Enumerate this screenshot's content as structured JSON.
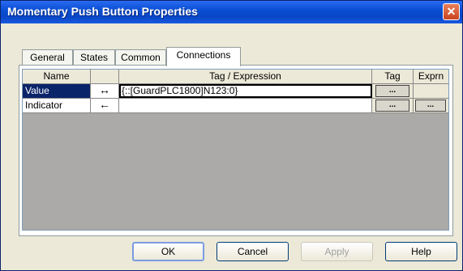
{
  "window": {
    "title": "Momentary Push Button Properties"
  },
  "tabs": [
    {
      "label": "General"
    },
    {
      "label": "States"
    },
    {
      "label": "Common"
    },
    {
      "label": "Connections"
    }
  ],
  "active_tab": "Connections",
  "grid": {
    "headers": {
      "name": "Name",
      "direction": "",
      "tag_expression": "Tag / Expression",
      "tag": "Tag",
      "exprn": "Exprn"
    },
    "rows": [
      {
        "name": "Value",
        "direction": "↔",
        "tag_expression": "{::[GuardPLC1800]N123:0}",
        "tag_button": "...",
        "exprn_button": ""
      },
      {
        "name": "Indicator",
        "direction": "←",
        "tag_expression": "",
        "tag_button": "...",
        "exprn_button": "..."
      }
    ]
  },
  "buttons": {
    "ok": "OK",
    "cancel": "Cancel",
    "apply": "Apply",
    "help": "Help"
  },
  "icons": {
    "close": "close-icon"
  }
}
